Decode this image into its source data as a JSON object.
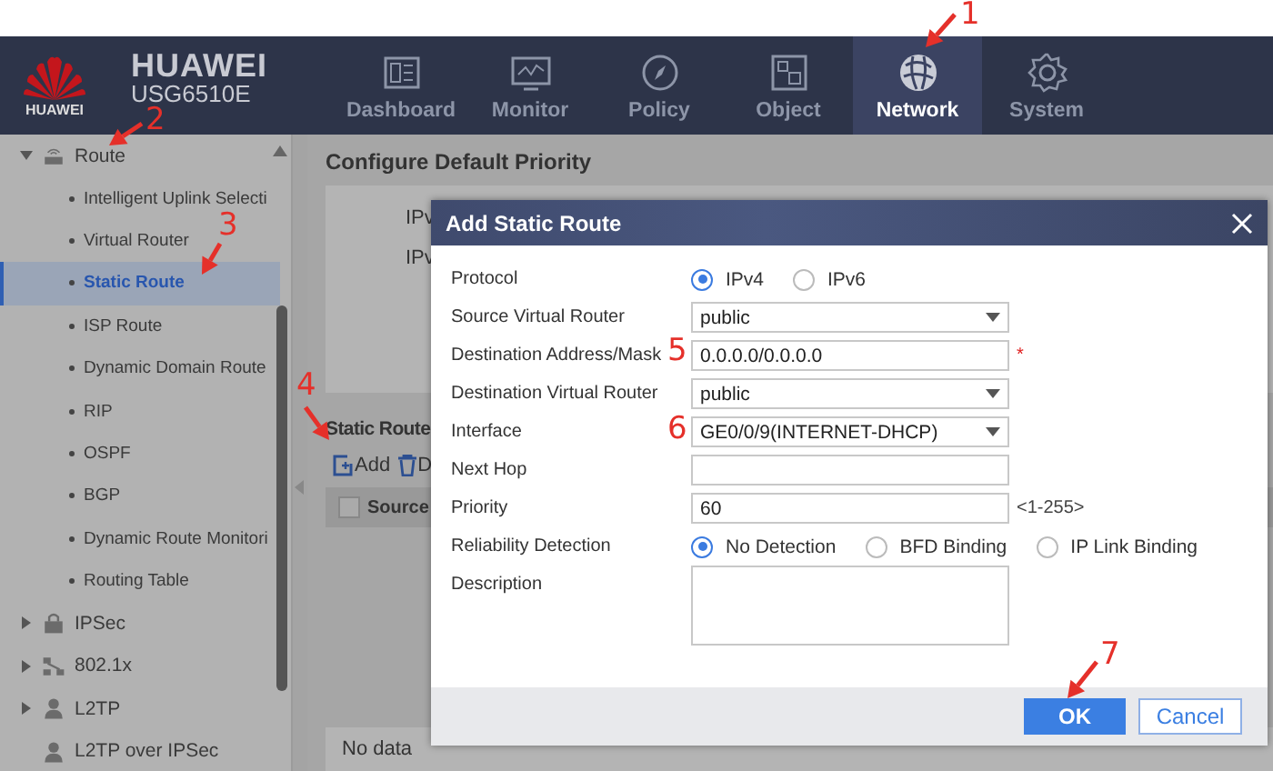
{
  "header": {
    "logo_text": "HUAWEI",
    "brand": "HUAWEI",
    "model": "USG6510E"
  },
  "nav": [
    {
      "label": "Dashboard",
      "selected": false
    },
    {
      "label": "Monitor",
      "selected": false
    },
    {
      "label": "Policy",
      "selected": false
    },
    {
      "label": "Object",
      "selected": false
    },
    {
      "label": "Network",
      "selected": true
    },
    {
      "label": "System",
      "selected": false
    }
  ],
  "sidebar": {
    "items": [
      {
        "label": "Route",
        "kind": "group",
        "expanded": true,
        "children": [
          {
            "label": "Intelligent Uplink Selecti",
            "selected": false
          },
          {
            "label": "Virtual Router",
            "selected": false
          },
          {
            "label": "Static Route",
            "selected": true
          },
          {
            "label": "ISP Route",
            "selected": false
          },
          {
            "label": "Dynamic Domain Route",
            "selected": false
          },
          {
            "label": "RIP",
            "selected": false
          },
          {
            "label": "OSPF",
            "selected": false
          },
          {
            "label": "BGP",
            "selected": false
          },
          {
            "label": "Dynamic Route Monitori",
            "selected": false
          },
          {
            "label": "Routing Table",
            "selected": false
          }
        ]
      },
      {
        "label": "IPSec",
        "kind": "group",
        "expanded": false
      },
      {
        "label": "802.1x",
        "kind": "group",
        "expanded": false
      },
      {
        "label": "L2TP",
        "kind": "group",
        "expanded": false
      },
      {
        "label": "L2TP over IPSec",
        "kind": "leaf",
        "expanded": false
      }
    ]
  },
  "main": {
    "title": "Configure Default Priority",
    "priority_labels": [
      "IPv",
      "IPv"
    ],
    "table_title": "Static Route",
    "toolbar": [
      "Add",
      "D"
    ],
    "select_all_checked": false,
    "columns": [
      "Source"
    ],
    "empty_text": "No data"
  },
  "dialog": {
    "title": "Add Static Route",
    "fields": [
      {
        "label": "Protocol",
        "kind": "radio",
        "options": [
          {
            "label": "IPv4",
            "selected": true
          },
          {
            "label": "IPv6",
            "selected": false
          }
        ]
      },
      {
        "label": "Source Virtual Router",
        "kind": "select",
        "value": "public"
      },
      {
        "label": "Destination Address/Mask",
        "kind": "text",
        "value": "0.0.0.0/0.0.0.0",
        "required_mark": "*"
      },
      {
        "label": "Destination Virtual Router",
        "kind": "select",
        "value": "public"
      },
      {
        "label": "Interface",
        "kind": "select",
        "value": "GE0/0/9(INTERNET-DHCP)"
      },
      {
        "label": "Next Hop",
        "kind": "text"
      },
      {
        "label": "Priority",
        "kind": "text",
        "value": "60",
        "hint": "<1-255>"
      },
      {
        "label": "Reliability Detection",
        "kind": "radio",
        "options": [
          {
            "label": "No Detection",
            "selected": true
          },
          {
            "label": "BFD Binding",
            "selected": false
          },
          {
            "label": "IP Link Binding",
            "selected": false
          }
        ]
      },
      {
        "label": "Description",
        "kind": "textarea"
      }
    ],
    "buttons": [
      {
        "label": "OK",
        "kind": "primary"
      },
      {
        "label": "Cancel",
        "kind": "secondary"
      }
    ]
  },
  "annotations": [
    {
      "number": "1",
      "kind": "arrow"
    },
    {
      "number": "2",
      "kind": "arrow"
    },
    {
      "number": "3",
      "kind": "arrow"
    },
    {
      "number": "4",
      "kind": "arrow"
    },
    {
      "number": "5",
      "kind": "plain"
    },
    {
      "number": "6",
      "kind": "plain"
    },
    {
      "number": "7",
      "kind": "arrow"
    }
  ]
}
